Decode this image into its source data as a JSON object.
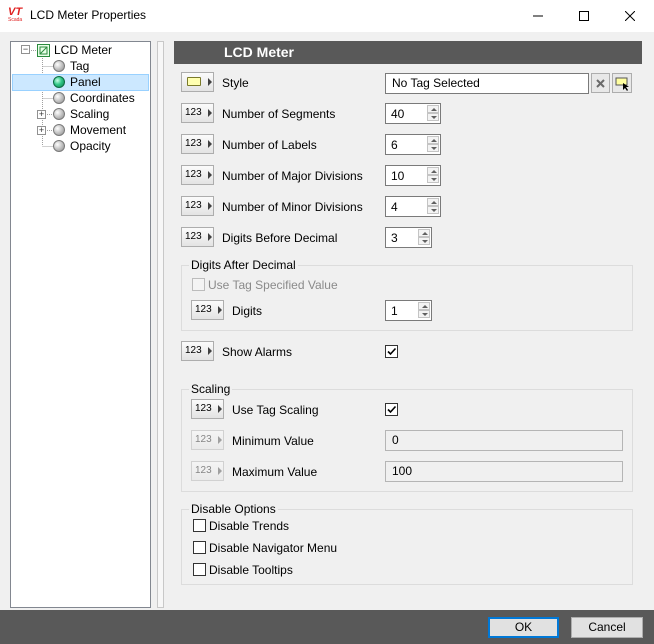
{
  "window": {
    "title": "LCD Meter Properties",
    "logo_text": "VT",
    "logo_sub": "Scada"
  },
  "tree": {
    "root": "LCD Meter",
    "items": [
      {
        "label": "Tag"
      },
      {
        "label": "Panel"
      },
      {
        "label": "Coordinates"
      },
      {
        "label": "Scaling"
      },
      {
        "label": "Movement"
      },
      {
        "label": "Opacity"
      }
    ]
  },
  "panel": {
    "header": "LCD Meter",
    "style": {
      "label": "Style",
      "value": "No Tag Selected"
    },
    "segments": {
      "label": "Number of Segments",
      "value": "40"
    },
    "labels": {
      "label": "Number of Labels",
      "value": "6"
    },
    "major": {
      "label": "Number of Major Divisions",
      "value": "10"
    },
    "minor": {
      "label": "Number of Minor Divisions",
      "value": "4"
    },
    "before_decimal": {
      "label": "Digits Before Decimal",
      "value": "3"
    },
    "after_decimal": {
      "title": "Digits After Decimal",
      "use_tag": "Use Tag Specified Value",
      "digits_label": "Digits",
      "digits_value": "1"
    },
    "show_alarms": {
      "label": "Show Alarms"
    },
    "scaling": {
      "title": "Scaling",
      "use_tag": "Use Tag Scaling",
      "min_label": "Minimum Value",
      "min_value": "0",
      "max_label": "Maximum Value",
      "max_value": "100"
    },
    "disable": {
      "title": "Disable Options",
      "trends": "Disable Trends",
      "navigator": "Disable Navigator Menu",
      "tooltips": "Disable Tooltips"
    },
    "numeric_icon": "123"
  },
  "footer": {
    "ok": "OK",
    "cancel": "Cancel"
  }
}
